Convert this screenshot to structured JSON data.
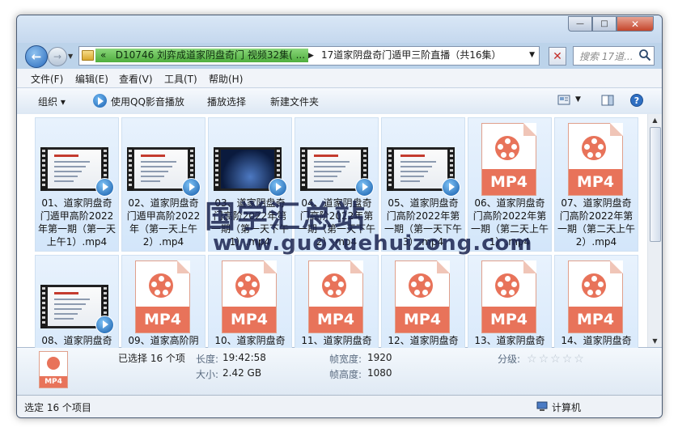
{
  "window": {
    "controls": {
      "minimize": "—",
      "maximize": "□",
      "close": "✕"
    }
  },
  "nav": {
    "back_icon": "←",
    "forward_icon": "→",
    "breadcrumb": [
      {
        "prefix": "«",
        "label": "D10746 刘弈成道家阴盘奇门 视频32集( ..."
      },
      {
        "label": "17道家阴盘奇门遁甲三阶直播（共16集）"
      }
    ],
    "search_placeholder": "搜索 17道..."
  },
  "menu": [
    "文件(F)",
    "编辑(E)",
    "查看(V)",
    "工具(T)",
    "帮助(H)"
  ],
  "toolbar": {
    "organize": "组织 ▾",
    "play_qq": "使用QQ影音播放",
    "play_selection": "播放选择",
    "new_folder": "新建文件夹"
  },
  "files": [
    {
      "name": "01、道家阴盘奇门遁甲高阶2022年第一期（第一天上午1）.mp4",
      "thumb": "video"
    },
    {
      "name": "02、道家阴盘奇门遁甲高阶2022年（第一天上午2）.mp4",
      "thumb": "video"
    },
    {
      "name": "03、道家阴盘奇门高阶2022年第一期（第一天下午1）.mp4",
      "thumb": "video-dark"
    },
    {
      "name": "04、道家阴盘奇门高阶2022年第一期（第一天下午2）.mp4",
      "thumb": "video"
    },
    {
      "name": "05、道家阴盘奇门高阶2022年第一期（第一天下午3）.mp4",
      "thumb": "video"
    },
    {
      "name": "06、道家阴盘奇门高阶2022年第一期（第二天上午1）.mp4",
      "thumb": "mp4"
    },
    {
      "name": "07、道家阴盘奇门高阶2022年第一期（第二天上午2）.mp4",
      "thumb": "mp4"
    },
    {
      "name": "08、道家阴盘奇",
      "thumb": "video"
    },
    {
      "name": "09、道家高阶阴",
      "thumb": "mp4"
    },
    {
      "name": "10、道家阴盘奇",
      "thumb": "mp4"
    },
    {
      "name": "11、道家阴盘奇",
      "thumb": "mp4"
    },
    {
      "name": "12、道家阴盘奇",
      "thumb": "mp4"
    },
    {
      "name": "13、道家阴盘奇",
      "thumb": "mp4"
    },
    {
      "name": "14、道家阴盘奇",
      "thumb": "mp4"
    }
  ],
  "mp4_label": "MP4",
  "watermark": {
    "cn": "国学汇总站",
    "url": "www.guoxuehuizong.com"
  },
  "details": {
    "selected": "已选择 16 个项",
    "length_label": "长度:",
    "length": "19:42:58",
    "size_label": "大小:",
    "size": "2.42 GB",
    "width_label": "帧宽度:",
    "width": "1920",
    "height_label": "帧高度:",
    "height": "1080",
    "rating_label": "分级:",
    "rating": 0,
    "icon_label": "MP4"
  },
  "status": {
    "left": "选定 16 个项目",
    "right": "计算机"
  }
}
